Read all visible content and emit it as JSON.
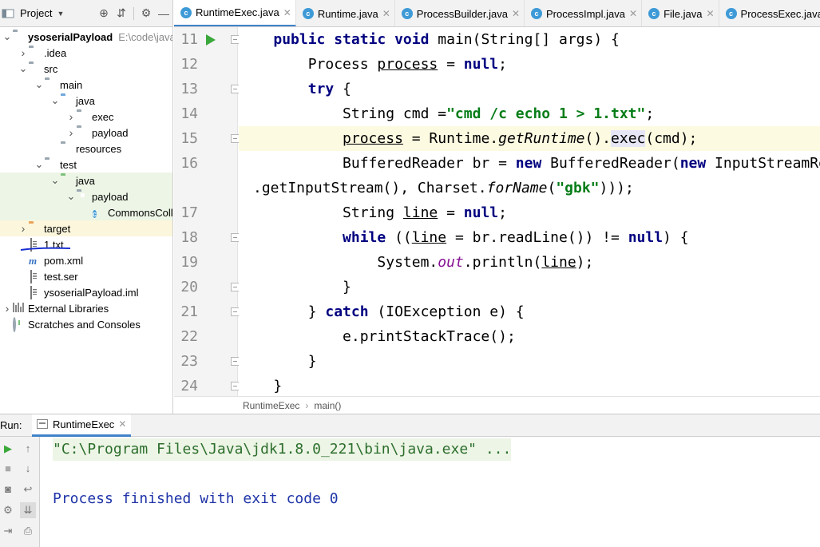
{
  "project_panel": {
    "title": "Project",
    "tree": [
      {
        "label": "ysoserialPayload",
        "hint": "E:\\code\\java\\",
        "depth": 0,
        "arrow": "down",
        "icon": "folder-module-icon",
        "bold": true
      },
      {
        "label": ".idea",
        "depth": 1,
        "arrow": "right",
        "icon": "folder-icon"
      },
      {
        "label": "src",
        "depth": 1,
        "arrow": "down",
        "icon": "folder-icon"
      },
      {
        "label": "main",
        "depth": 2,
        "arrow": "down",
        "icon": "folder-icon"
      },
      {
        "label": "java",
        "depth": 3,
        "arrow": "down",
        "icon": "folder-source-icon"
      },
      {
        "label": "exec",
        "depth": 4,
        "arrow": "right",
        "icon": "package-icon"
      },
      {
        "label": "payload",
        "depth": 4,
        "arrow": "right",
        "icon": "package-icon"
      },
      {
        "label": "resources",
        "depth": 3,
        "arrow": "none",
        "icon": "folder-resources-icon"
      },
      {
        "label": "test",
        "depth": 2,
        "arrow": "down",
        "icon": "folder-icon"
      },
      {
        "label": "java",
        "depth": 3,
        "arrow": "down",
        "icon": "folder-test-icon",
        "highlight": true
      },
      {
        "label": "payload",
        "depth": 4,
        "arrow": "down",
        "icon": "package-icon",
        "highlight": true
      },
      {
        "label": "CommonsColle",
        "depth": 5,
        "arrow": "none",
        "icon": "java-class-icon",
        "highlight": true
      },
      {
        "label": "target",
        "depth": 1,
        "arrow": "right",
        "icon": "folder-excluded-icon",
        "selected": true
      },
      {
        "label": "1.txt",
        "depth": 1,
        "arrow": "none",
        "icon": "text-file-icon"
      },
      {
        "label": "pom.xml",
        "depth": 1,
        "arrow": "none",
        "icon": "maven-icon"
      },
      {
        "label": "test.ser",
        "depth": 1,
        "arrow": "none",
        "icon": "text-file-icon"
      },
      {
        "label": "ysoserialPayload.iml",
        "depth": 1,
        "arrow": "none",
        "icon": "iml-file-icon"
      },
      {
        "label": "External Libraries",
        "depth": 0,
        "arrow": "right",
        "icon": "libraries-icon"
      },
      {
        "label": "Scratches and Consoles",
        "depth": 0,
        "arrow": "none",
        "icon": "scratches-icon"
      }
    ]
  },
  "editor": {
    "tabs": [
      {
        "label": "RuntimeExec.java",
        "active": true
      },
      {
        "label": "Runtime.java"
      },
      {
        "label": "ProcessBuilder.java"
      },
      {
        "label": "ProcessImpl.java"
      },
      {
        "label": "File.java"
      },
      {
        "label": "ProcessExec.java"
      }
    ],
    "line_numbers": [
      "11",
      "12",
      "13",
      "14",
      "15",
      "16",
      "",
      "17",
      "18",
      "19",
      "20",
      "21",
      "22",
      "23",
      "24"
    ],
    "breadcrumb": [
      "RuntimeExec",
      "main()"
    ]
  },
  "run_panel": {
    "label": "Run:",
    "tab": "RuntimeExec",
    "console": [
      "\"C:\\Program Files\\Java\\jdk1.8.0_221\\bin\\java.exe\" ...",
      "",
      "Process finished with exit code 0"
    ]
  },
  "colors": {
    "accent": "#4083c9",
    "keyword": "#000080",
    "string": "#067d17",
    "annotation_stroke": "#1a2fd0"
  }
}
